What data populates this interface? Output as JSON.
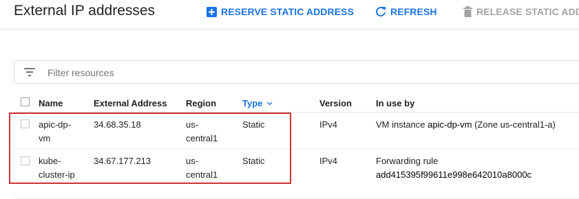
{
  "header": {
    "title": "External IP addresses",
    "reserve_label": "RESERVE STATIC ADDRESS",
    "refresh_label": "REFRESH",
    "release_label": "RELEASE STATIC ADDR"
  },
  "filter": {
    "placeholder": "Filter resources"
  },
  "table": {
    "columns": [
      "Name",
      "External Address",
      "Region",
      "Type",
      "Version",
      "In use by"
    ],
    "rows": [
      {
        "name": "apic-dp-vm",
        "address": "34.68.35.18",
        "region": "us-central1",
        "type": "Static",
        "version": "IPv4",
        "in_use_prefix": "VM instance",
        "in_use_target": "apic-dp-vm",
        "in_use_suffix": "(Zone us-central1-a)"
      },
      {
        "name": "kube-cluster-ip",
        "address": "34.67.177.213",
        "region": "us-central1",
        "type": "Static",
        "version": "IPv4",
        "in_use_prefix": "Forwarding rule",
        "in_use_target": "add415395f99611e998e642010a8000c",
        "in_use_suffix": ""
      }
    ]
  },
  "icons": {
    "reserve": "add-box-icon",
    "refresh": "refresh-icon",
    "release": "delete-icon",
    "filter": "filter-list-icon",
    "sort": "chevron-down-icon"
  },
  "colors": {
    "accent": "#1a73e8",
    "disabled": "#a3a3a3",
    "highlight": "#d32f2f"
  }
}
